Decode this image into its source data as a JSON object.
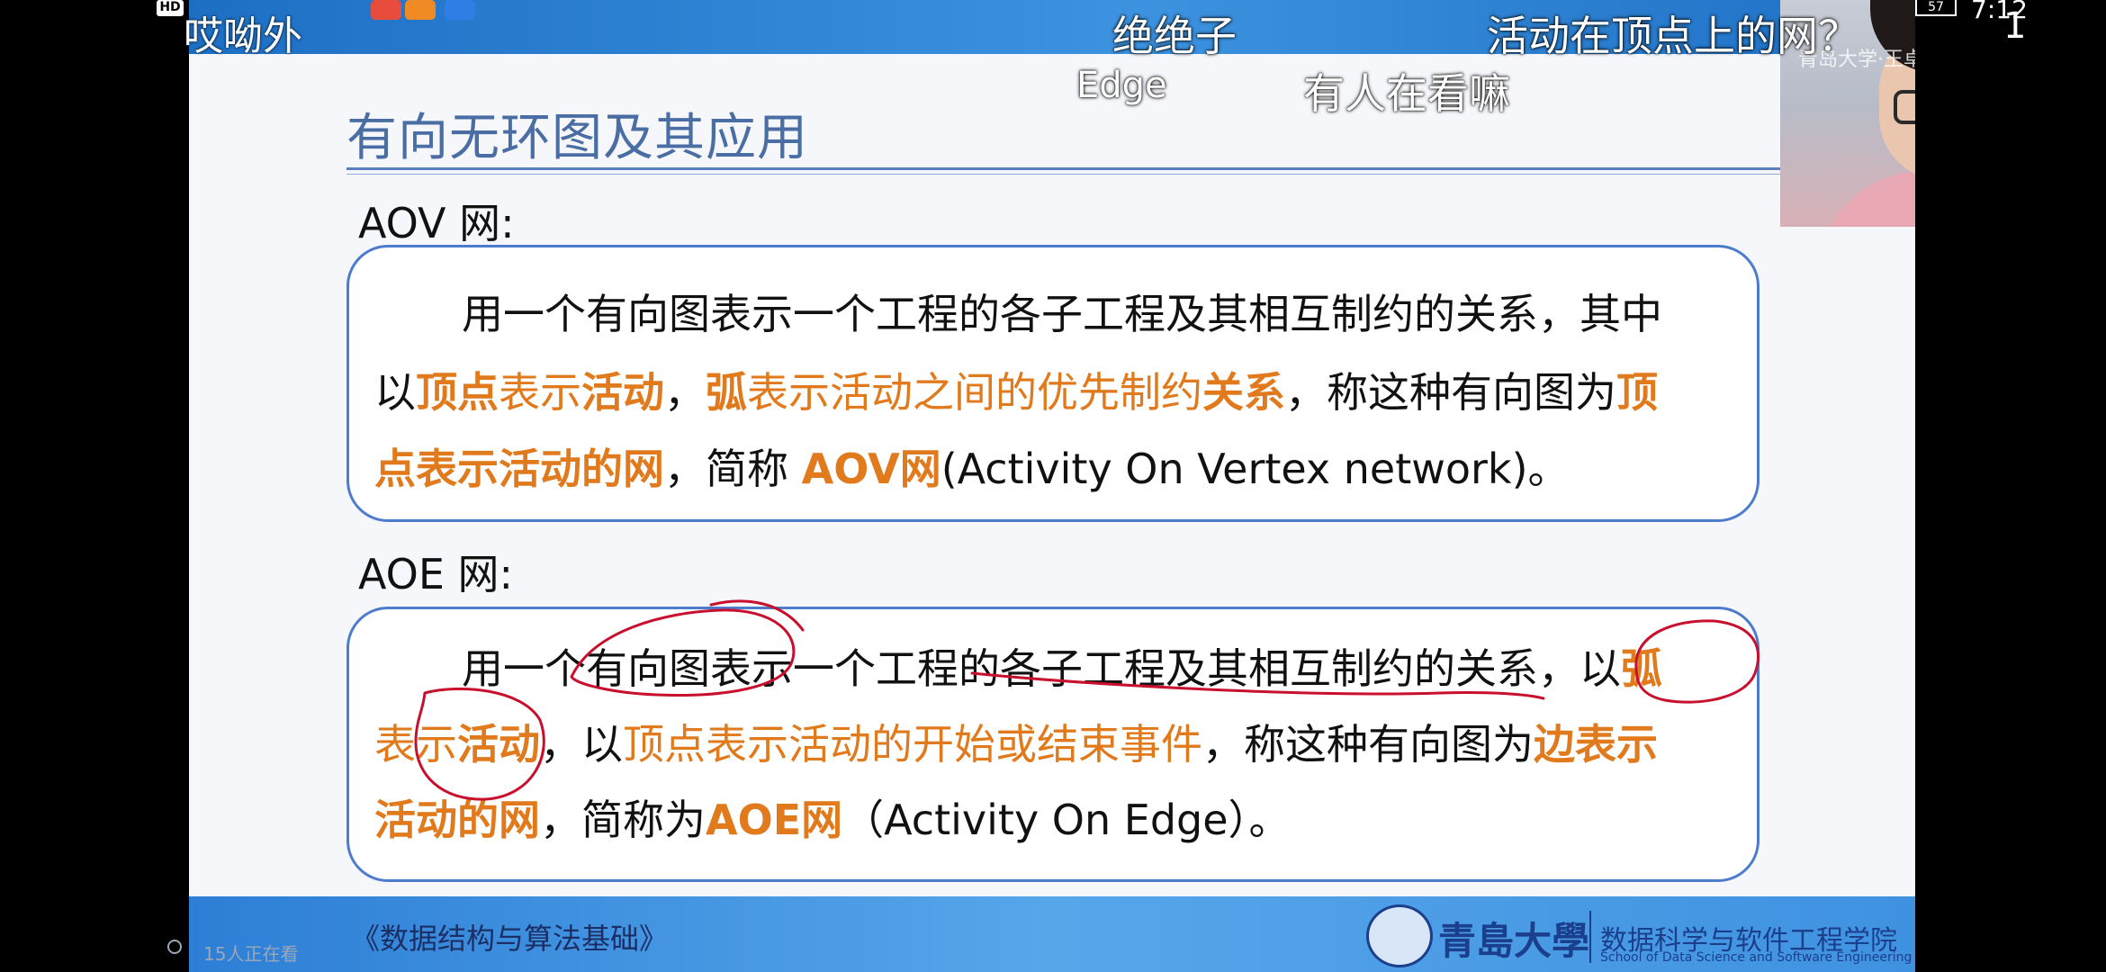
{
  "overlay": {
    "hd_badge": "HD",
    "top_left_text": "哎呦外",
    "danmaku": [
      "绝绝子",
      "活动在顶点上的网？",
      "Edge",
      "有人在看嘛"
    ],
    "battery": "57",
    "time": "7:12",
    "page_indicator": "1",
    "viewers": "15人正在看"
  },
  "slide": {
    "title": "有向无环图及其应用",
    "aov": {
      "label": "AOV 网:",
      "l1": "用一个有向图表示一个工程的各子工程及其相互制约的关系，其中",
      "l2a": "以",
      "l2b": "顶点",
      "l2c": "表示",
      "l2d": "活动",
      "l2e": "，",
      "l2f": "弧",
      "l2g": "表示活动之间的优先制约",
      "l2h": "关系",
      "l2i": "，称这种有向图为",
      "l2j": "顶",
      "l3a": "点表示活动的网",
      "l3b": "，简称 ",
      "l3c": "AOV网",
      "l3d": "(Activity On Vertex network)。"
    },
    "aoe": {
      "label": "AOE 网:",
      "l1a": "用一个有向图表示一个工程的各子工程及其相互制约的关系，",
      "l1b": "以",
      "l1c": "弧",
      "l2a": "表示",
      "l2b": "活动",
      "l2c": "，以",
      "l2d": "顶点表示活动的开始或结束事件",
      "l2e": "，称这种有向图为",
      "l2f": "边表示",
      "l3a": "活动的网",
      "l3b": "，简称为",
      "l3c": "AOE网",
      "l3d": "（Activity  On  Edge）。"
    },
    "footer": {
      "course": "《数据结构与算法基础》",
      "university": "青島大學",
      "school_cn": "数据科学与软件工程学院",
      "school_en": "School of Data Science and Software Engineering"
    },
    "webcam_watermark": "青岛大学·王卓 bilibili"
  },
  "colors": {
    "highlight": "#e07a1c",
    "box_border": "#4d7ccc",
    "annotation": "#c8102e"
  }
}
